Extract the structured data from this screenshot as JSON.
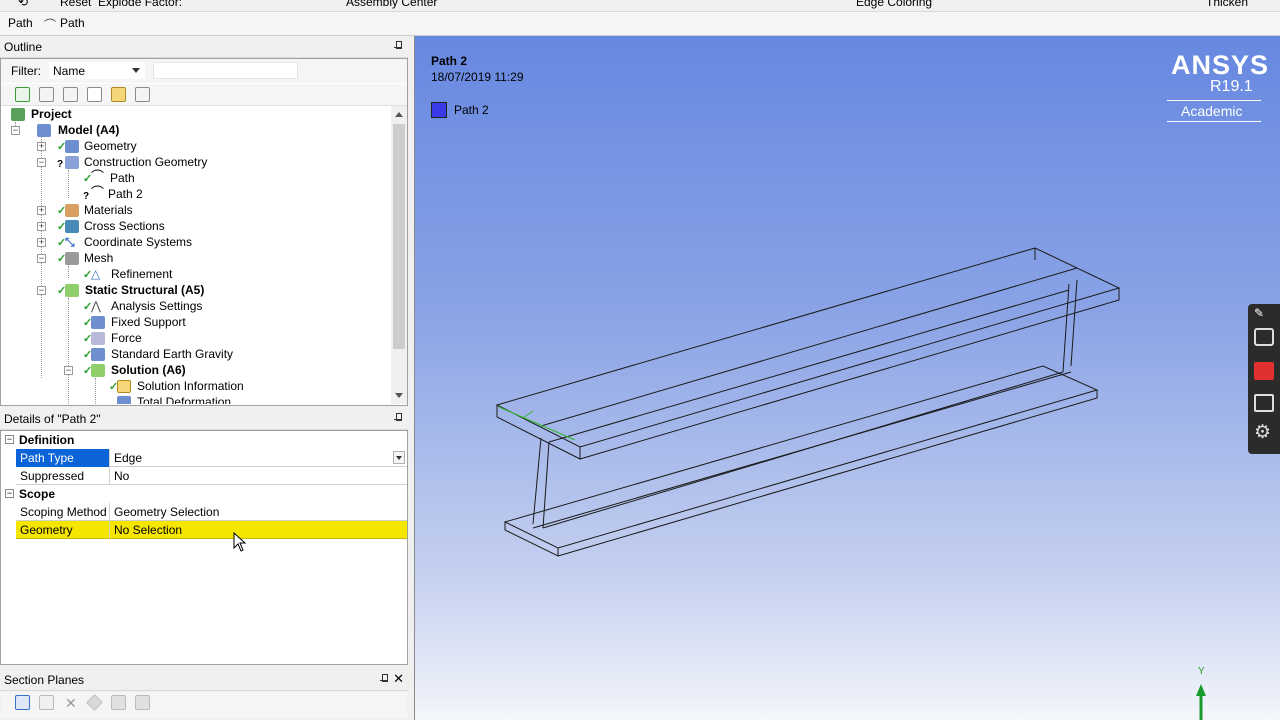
{
  "toolbar_top": {
    "reset_label": "Reset",
    "explode_label": "Explode Factor:",
    "assembly_center": "Assembly Center",
    "edge_coloring": "Edge Coloring",
    "thicken": "Thicken"
  },
  "toolbar_path": {
    "item1": "Path",
    "item2": "Path"
  },
  "outline": {
    "title": "Outline",
    "filter_label": "Filter:",
    "filter_value": "Name",
    "filter_text": ""
  },
  "tree": {
    "project": "Project",
    "model": "Model (A4)",
    "geometry": "Geometry",
    "construction_geometry": "Construction Geometry",
    "path": "Path",
    "path2": "Path 2",
    "materials": "Materials",
    "cross_sections": "Cross Sections",
    "coordinate_systems": "Coordinate Systems",
    "mesh": "Mesh",
    "refinement": "Refinement",
    "static_structural": "Static Structural (A5)",
    "analysis_settings": "Analysis Settings",
    "fixed_support": "Fixed Support",
    "force": "Force",
    "standard_earth_gravity": "Standard Earth Gravity",
    "solution": "Solution (A6)",
    "solution_information": "Solution Information",
    "total_deformation": "Total Deformation"
  },
  "details": {
    "title": "Details of \"Path 2\"",
    "group_definition": "Definition",
    "path_type_label": "Path Type",
    "path_type_value": "Edge",
    "suppressed_label": "Suppressed",
    "suppressed_value": "No",
    "group_scope": "Scope",
    "scoping_method_label": "Scoping Method",
    "scoping_method_value": "Geometry Selection",
    "geometry_label": "Geometry",
    "geometry_value": "No Selection"
  },
  "section_planes": {
    "title": "Section Planes"
  },
  "viewport": {
    "title": "Path 2",
    "timestamp": "18/07/2019 11:29",
    "legend_label": "Path 2",
    "legend_color": "#3a3ae8",
    "brand_name": "ANSYS",
    "brand_version": "R19.1",
    "brand_edition": "Academic",
    "axis_y": "Y"
  }
}
